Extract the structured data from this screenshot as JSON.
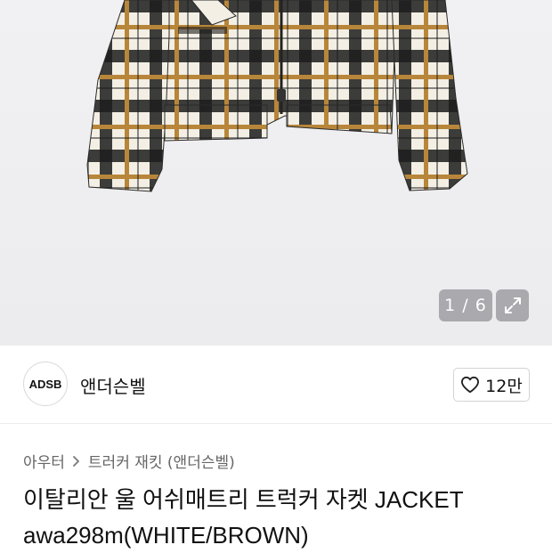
{
  "gallery": {
    "counter": "1 / 6",
    "current_image": 1,
    "total_images": 6,
    "colors": {
      "cream": "#f3efe4",
      "brown": "#b8863a",
      "black": "#1c1c1c"
    }
  },
  "seller": {
    "avatar_text": "ADSB",
    "name": "앤더슨벨"
  },
  "like": {
    "count": "12만"
  },
  "breadcrumb": {
    "category": "아우터",
    "separator": ">",
    "subcategory": "트러커 재킷 (앤더슨벨)"
  },
  "product": {
    "title": "이탈리안 울 어쉬매트리 트럭커 자켓 JACKET awa298m(WHITE/BROWN)"
  },
  "icons": {
    "expand": "expand-icon",
    "heart": "heart-outline-icon",
    "chevron": "chevron-right-icon"
  }
}
